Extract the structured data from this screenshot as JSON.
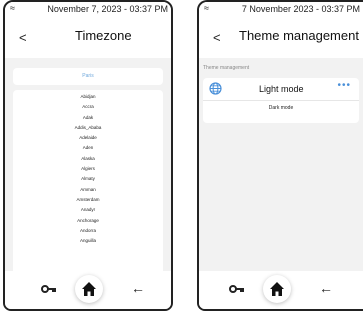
{
  "screen_timezone": {
    "status": {
      "time": "November 7, 2023 - 03:37 PM"
    },
    "header": {
      "back_icon": "chevron-left-icon",
      "title": "Timezone"
    },
    "selected_timezone": "Paris",
    "timezones": [
      "Abidjan",
      "Accra",
      "Adak",
      "Addis_Ababa",
      "Adelaide",
      "Aden",
      "Alaska",
      "Algiers",
      "Almaty",
      "Amman",
      "Amsterdam",
      "Anadyr",
      "Anchorage",
      "Andorra",
      "Anguilla"
    ]
  },
  "screen_theme": {
    "status": {
      "time": "7 November 2023 - 03:37 PM"
    },
    "header": {
      "back_icon": "chevron-left-icon",
      "title": "Theme management"
    },
    "section_label": "Theme management",
    "options": {
      "light": "Light mode",
      "dark": "Dark mode"
    },
    "more_icon": "more-horizontal-icon",
    "globe_icon": "globe-icon"
  },
  "navbar": {
    "icons": [
      "key-icon",
      "home-icon",
      "arrow-left-icon"
    ]
  },
  "colors": {
    "accent": "#4a90d9",
    "selected_text": "#6fa8dc",
    "background": "#f2f2f2"
  }
}
